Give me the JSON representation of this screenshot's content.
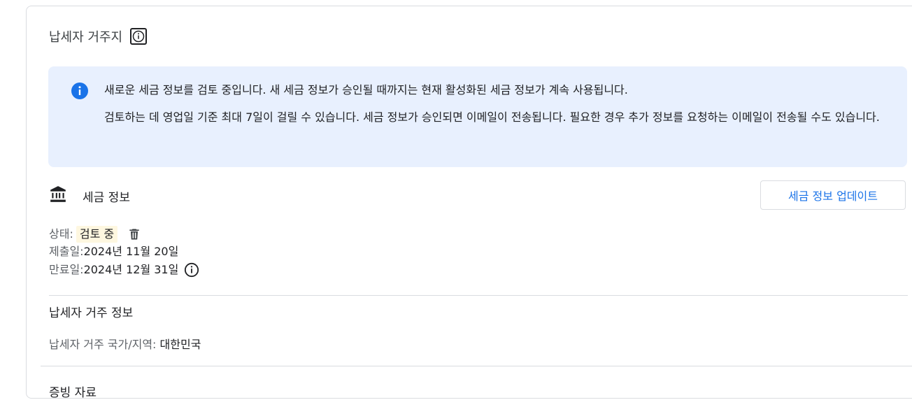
{
  "section": {
    "title": "납세자 거주지"
  },
  "banner": {
    "line1": "새로운 세금 정보를 검토 중입니다. 새 세금 정보가 승인될 때까지는 현재 활성화된 세금 정보가 계속 사용됩니다.",
    "line2": "검토하는 데 영업일 기준 최대 7일이 걸릴 수 있습니다. 세금 정보가 승인되면 이메일이 전송됩니다. 필요한 경우 추가 정보를 요청하는 이메일이 전송될 수도 있습니다.",
    "icon": "info-icon",
    "color": "#1a73e8"
  },
  "tax_info": {
    "label": "세금 정보",
    "icon": "bank-icon",
    "update_button": "세금 정보 업데이트",
    "status_label": "상태:",
    "status_value": "검토 중",
    "submitted_label": "제출일:",
    "submitted_value": "2024년 11월 20일",
    "expires_label": "만료일:",
    "expires_value": "2024년 12월 31일"
  },
  "residency": {
    "title": "납세자 거주 정보",
    "country_label": "납세자 거주 국가/지역:",
    "country_value": "대한민국"
  },
  "next_section": {
    "title": "증빙 자료"
  }
}
